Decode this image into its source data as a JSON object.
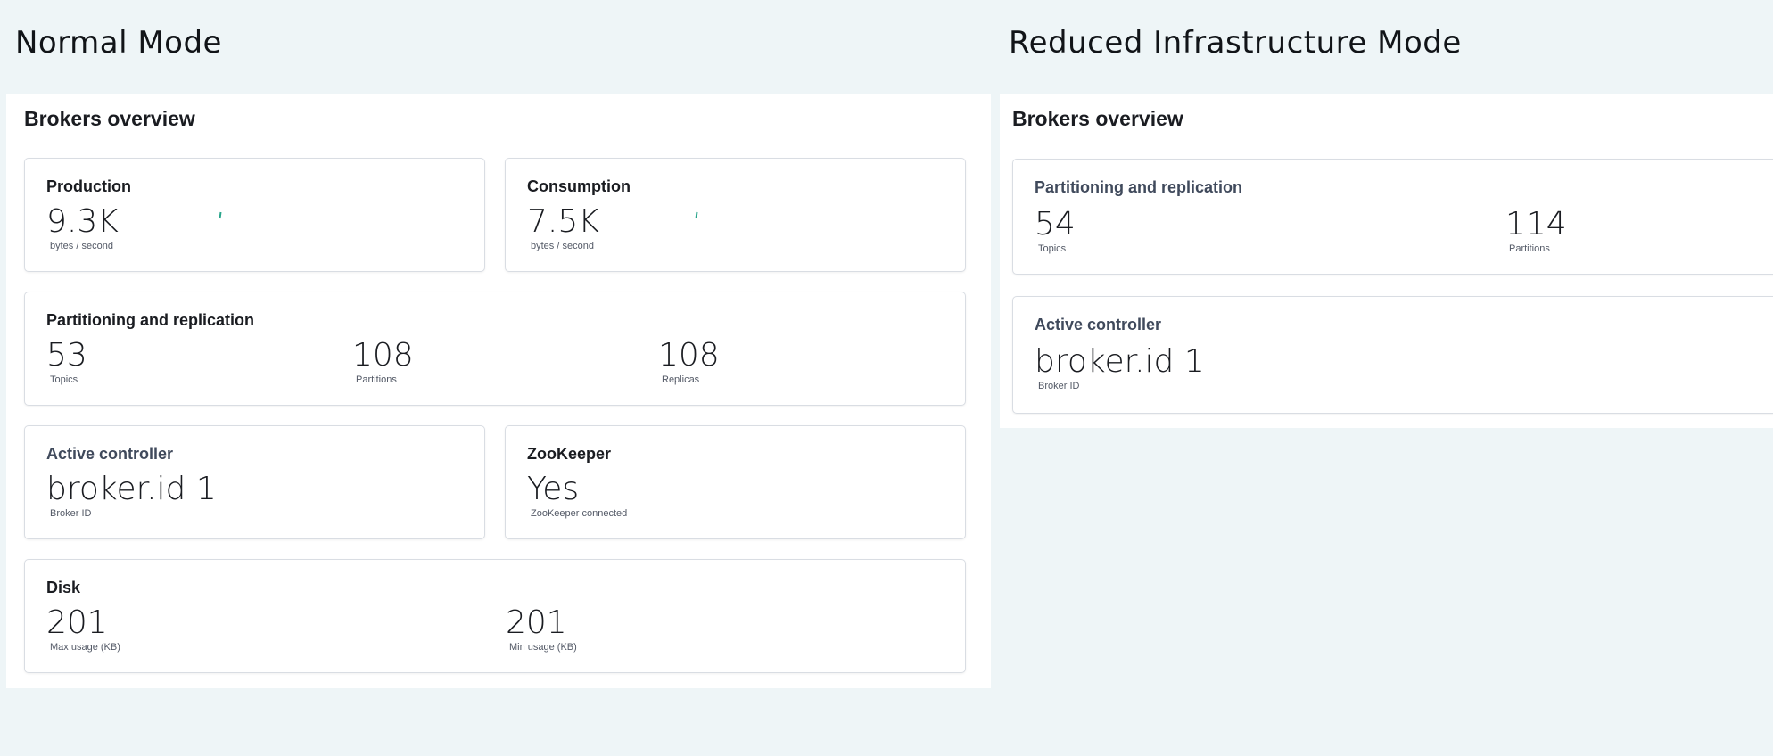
{
  "normal": {
    "mode_title": "Normal Mode",
    "panel_title": "Brokers overview",
    "production": {
      "title": "Production",
      "value": "9.3K",
      "label": "bytes / second"
    },
    "consumption": {
      "title": "Consumption",
      "value": "7.5K",
      "label": "bytes / second"
    },
    "partitioning": {
      "title": "Partitioning and replication",
      "stats": [
        {
          "value": "53",
          "label": "Topics"
        },
        {
          "value": "108",
          "label": "Partitions"
        },
        {
          "value": "108",
          "label": "Replicas"
        }
      ]
    },
    "controller": {
      "title": "Active controller",
      "value": "broker.id 1",
      "label": "Broker ID"
    },
    "zookeeper": {
      "title": "ZooKeeper",
      "value": "Yes",
      "label": "ZooKeeper connected"
    },
    "disk": {
      "title": "Disk",
      "stats": [
        {
          "value": "201",
          "label": "Max usage (KB)"
        },
        {
          "value": "201",
          "label": "Min usage (KB)"
        }
      ]
    }
  },
  "reduced": {
    "mode_title": "Reduced Infrastructure Mode",
    "panel_title": "Brokers overview",
    "partitioning": {
      "title": "Partitioning and replication",
      "stats": [
        {
          "value": "54",
          "label": "Topics"
        },
        {
          "value": "114",
          "label": "Partitions"
        }
      ]
    },
    "controller": {
      "title": "Active controller",
      "value": "broker.id 1",
      "label": "Broker ID"
    }
  },
  "colors": {
    "background": "#eef5f7",
    "panel": "#ffffff",
    "card_border": "#d9dde3",
    "sparkline": "#2aa68c"
  }
}
